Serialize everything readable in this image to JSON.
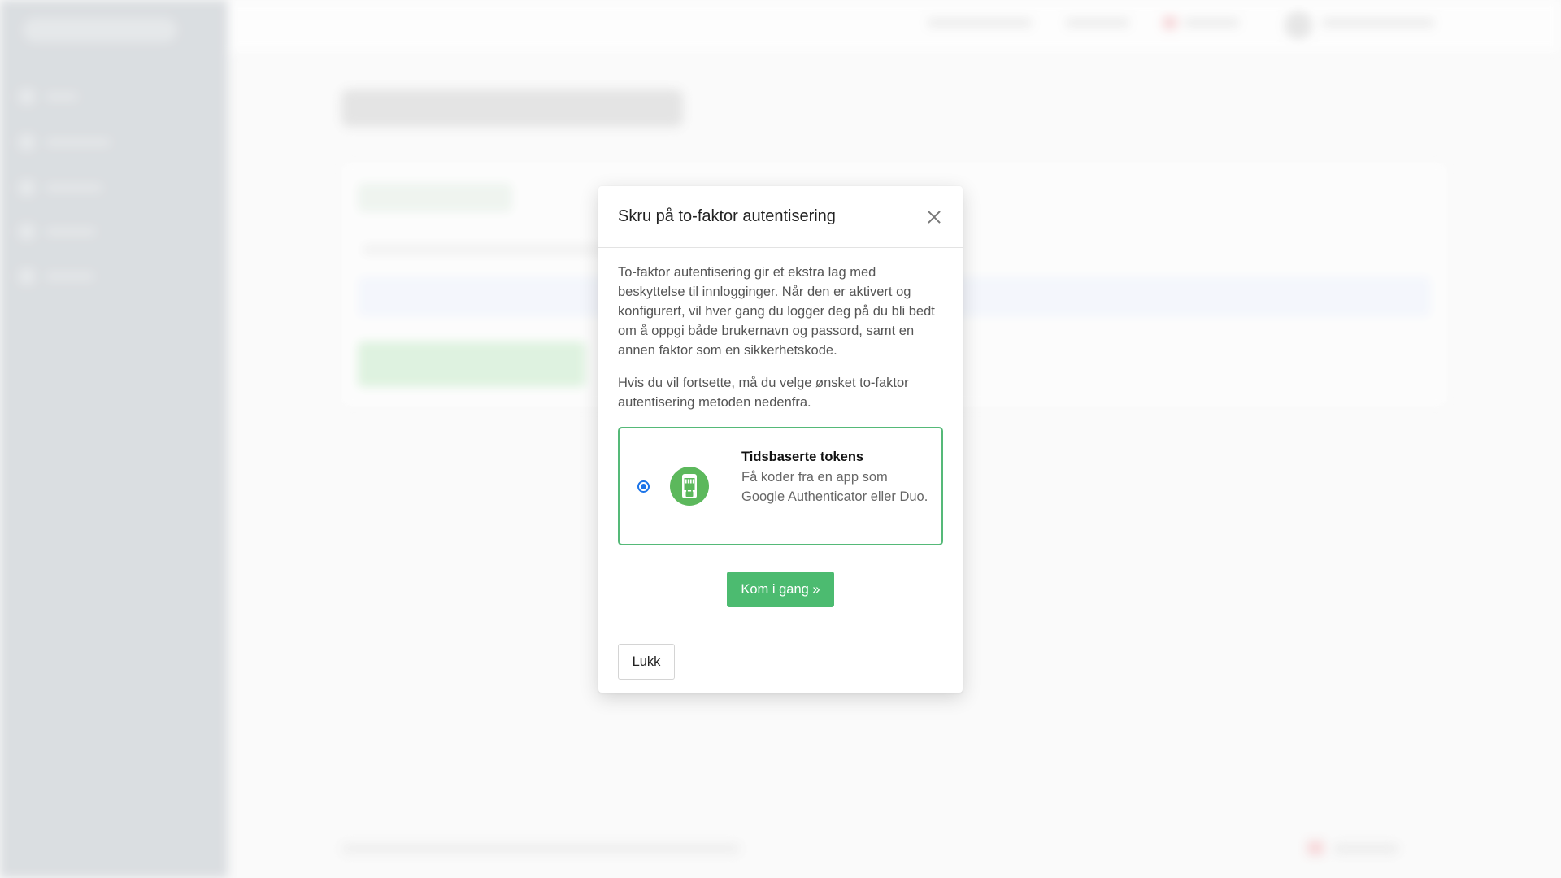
{
  "modal": {
    "title": "Skru på to-faktor autentisering",
    "intro": "To-faktor autentisering gir et ekstra lag med beskyttelse til innlogginger. Når den er aktivert og konfigurert, vil hver gang du logger deg på du bli bedt om å oppgi både brukernavn og passord, samt en annen faktor som en sikkerhetskode.",
    "instruction": "Hvis du vil fortsette, må du velge ønsket to-faktor autentisering metoden nedenfra.",
    "option": {
      "title": "Tidsbaserte tokens",
      "description": "Få koder fra en app som Google Authenticator eller Duo.",
      "selected": true,
      "icon": "phone-lock-icon"
    },
    "start_button": "Kom i gang »",
    "close_button": "Lukk"
  },
  "colors": {
    "accent_green": "#4cbb70",
    "option_border": "#55b978",
    "radio_blue": "#1a73e8",
    "sidebar": "#c7ccd1"
  }
}
